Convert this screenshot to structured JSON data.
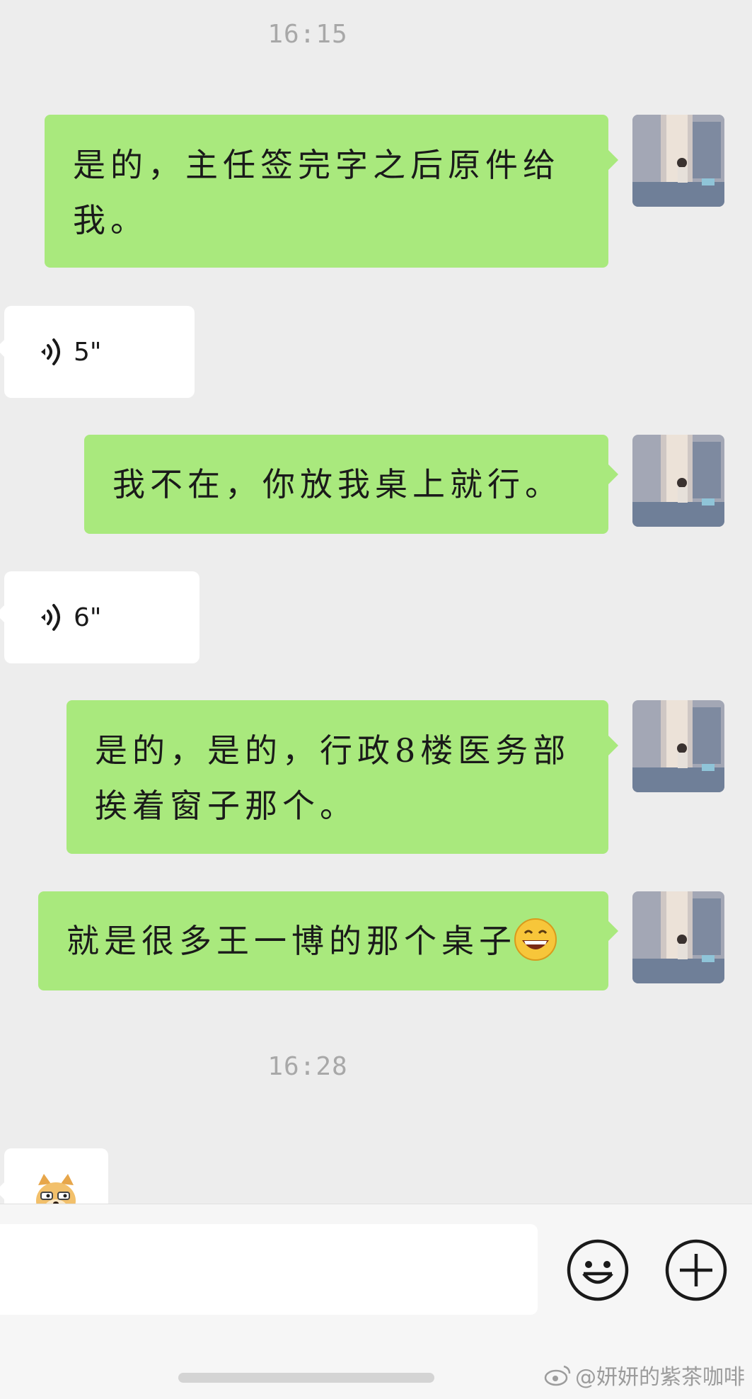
{
  "timestamps": [
    "16:15",
    "16:28"
  ],
  "messages": {
    "m1": "是的，主任签完字之后原件给我。",
    "m1_l1": "是的，主任签完字之后原件给",
    "m1_l2": "我。",
    "v1_duration": "5\"",
    "m2": "我不在，你放我桌上就行。",
    "v2_duration": "6\"",
    "m3_l1": "是的，是的，行政8楼医务部",
    "m3_l2": "挨着窗子那个。",
    "m4": "就是很多王一博的那个桌子"
  },
  "icons": {
    "voice": "voice-wave-icon",
    "emoji_in_message": "grin-emoji-icon",
    "sticker": "doge-sticker",
    "emoji_button": "smiley-face-icon",
    "plus_button": "plus-circle-icon",
    "weibo": "weibo-logo-icon"
  },
  "watermark": "@妍妍的紫茶咖啡",
  "colors": {
    "background": "#ededed",
    "sent_bubble": "#a9e97d",
    "received_bubble": "#ffffff",
    "timestamp": "#a8a8a8"
  }
}
